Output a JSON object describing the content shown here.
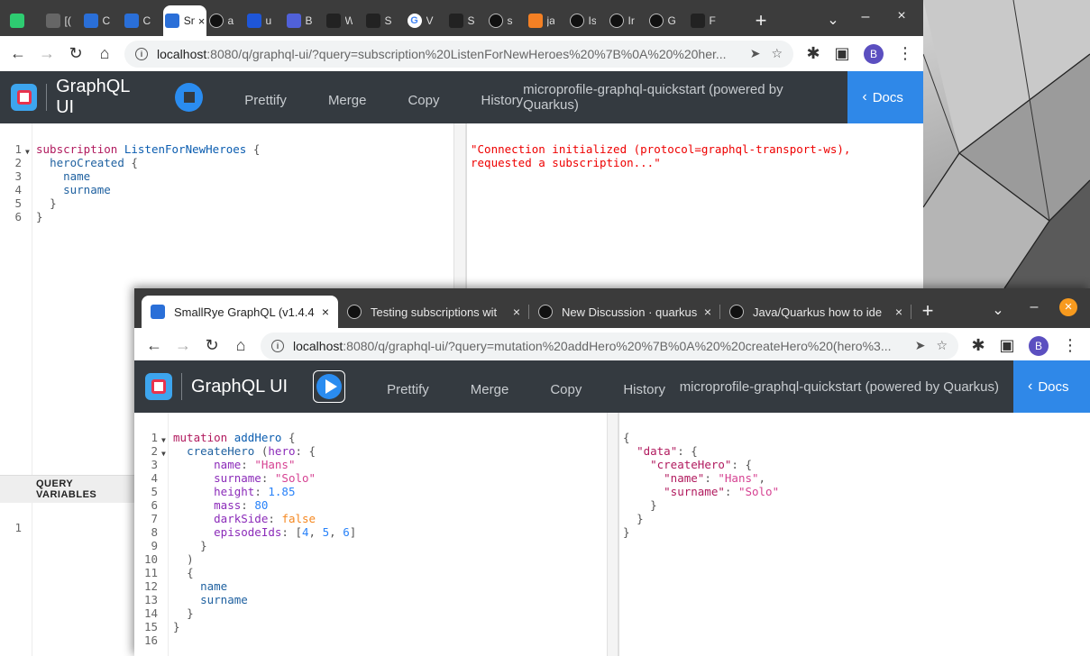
{
  "win1": {
    "tabs": [
      {
        "title": "",
        "icon": "leaf-icon",
        "color": "#2ecc71"
      },
      {
        "title": "[(",
        "icon": "picture-icon",
        "color": "#666666"
      },
      {
        "title": "C",
        "icon": "graphql-icon",
        "color": "#2a6fd8"
      },
      {
        "title": "C",
        "icon": "graphql-icon",
        "color": "#2a6fd8"
      },
      {
        "title": "Sm",
        "icon": "graphql-icon",
        "color": "#2a6fd8",
        "active": true
      },
      {
        "title": "a",
        "icon": "github-icon",
        "color": "#222222"
      },
      {
        "title": "u",
        "icon": "flag-icon",
        "color": "#1e56d9"
      },
      {
        "title": "B",
        "icon": "circle-icon",
        "color": "#5061d9"
      },
      {
        "title": "W",
        "icon": "apollo-icon",
        "color": "#222222"
      },
      {
        "title": "S",
        "icon": "apollo-icon",
        "color": "#222222"
      },
      {
        "title": "V",
        "icon": "google-icon",
        "color": "#ffffff"
      },
      {
        "title": "S",
        "icon": "cube-icon",
        "color": "#222222"
      },
      {
        "title": "s",
        "icon": "github-icon",
        "color": "#222222"
      },
      {
        "title": "ja",
        "icon": "stack-icon",
        "color": "#f48024"
      },
      {
        "title": "Is",
        "icon": "github-icon",
        "color": "#222222"
      },
      {
        "title": "Ir",
        "icon": "github-icon",
        "color": "#222222"
      },
      {
        "title": "G",
        "icon": "github-icon",
        "color": "#222222"
      },
      {
        "title": "F",
        "icon": "infinity-icon",
        "color": "#222222"
      }
    ],
    "url_host": "localhost",
    "url_rest": ":8080/q/graphql-ui/?query=subscription%20ListenForNewHeroes%20%7B%0A%20%20her...",
    "avatar": "B",
    "app_title": "GraphQL UI",
    "buttons": [
      "Prettify",
      "Merge",
      "Copy",
      "History"
    ],
    "info": "microprofile-graphql-quickstart (powered by Quarkus)",
    "docs": "Docs",
    "query_lines": [
      "1",
      "2",
      "3",
      "4",
      "5",
      "6"
    ],
    "response_msg": "\"Connection initialized (protocol=graphql-transport-ws),\nrequested a subscription...\"",
    "query_variables": "QUERY VARIABLES",
    "var_line": "1"
  },
  "win2": {
    "tabs": [
      {
        "title": "SmallRye GraphQL (v1.4.4",
        "icon": "graphql-icon",
        "active": true
      },
      {
        "title": "Testing subscriptions wit",
        "icon": "github-icon"
      },
      {
        "title": "New Discussion · quarkus",
        "icon": "github-icon"
      },
      {
        "title": "Java/Quarkus how to ide",
        "icon": "github-icon"
      }
    ],
    "url_host": "localhost",
    "url_rest": ":8080/q/graphql-ui/?query=mutation%20addHero%20%7B%0A%20%20createHero%20(hero%3...",
    "avatar": "B",
    "app_title": "GraphQL UI",
    "buttons": [
      "Prettify",
      "Merge",
      "Copy",
      "History"
    ],
    "info": "microprofile-graphql-quickstart (powered by Quarkus)",
    "docs": "Docs",
    "query_lines": [
      "1",
      "2",
      "3",
      "4",
      "5",
      "6",
      "7",
      "8",
      "9",
      "10",
      "11",
      "12",
      "13",
      "14",
      "15",
      "16"
    ]
  },
  "icons": {
    "close": "×",
    "new_tab": "+",
    "minimize": "–",
    "chevron": "⌄",
    "back": "←",
    "forward": "→",
    "reload": "↻",
    "home": "⌂",
    "share": "➤",
    "star": "☆",
    "puzzle": "✱",
    "sidebar": "▣",
    "menu": "⋮",
    "docs_chev": "‹"
  }
}
